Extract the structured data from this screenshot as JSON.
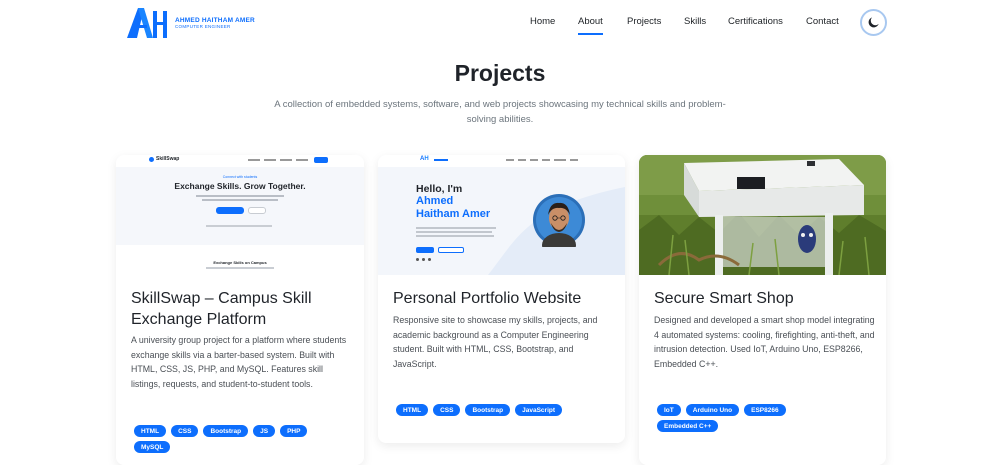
{
  "brand": {
    "mark": "AH",
    "name": "AHMED HAITHAM AMER",
    "subtitle": "COMPUTER ENGINEER"
  },
  "nav": {
    "items": [
      {
        "label": "Home"
      },
      {
        "label": "About"
      },
      {
        "label": "Projects"
      },
      {
        "label": "Skills"
      },
      {
        "label": "Certifications"
      },
      {
        "label": "Contact"
      }
    ],
    "active": "About",
    "theme_icon": "moon-icon"
  },
  "section": {
    "title": "Projects",
    "subtitle": "A collection of embedded systems, software, and web projects showcasing my technical skills and problem-solving abilities."
  },
  "projects": [
    {
      "title": "SkillSwap – Campus Skill Exchange Platform",
      "description": "A university group project for a platform where students exchange skills via a barter-based system. Built with HTML, CSS, JS, PHP, and MySQL. Features skill listings, requests, and student-to-student tools.",
      "tags": [
        "HTML",
        "CSS",
        "Bootstrap",
        "JS",
        "PHP",
        "MySQL"
      ],
      "thumb": {
        "logo": "SkillSwap",
        "headline": "Exchange Skills. Grow Together.",
        "kicker": "Connect with students",
        "section": "Exchange Skills on Campus"
      }
    },
    {
      "title": "Personal Portfolio Website",
      "description": "Responsive site to showcase my skills, projects, and academic background as a Computer Engineering student. Built with HTML, CSS, Bootstrap, and JavaScript.",
      "tags": [
        "HTML",
        "CSS",
        "Bootstrap",
        "JavaScript"
      ],
      "thumb": {
        "hello": "Hello, I'm",
        "name1": "Ahmed",
        "name2": "Haitham Amer"
      }
    },
    {
      "title": "Secure Smart Shop",
      "description": "Designed and developed a smart shop model integrating 4 automated systems: cooling, firefighting, anti-theft, and intrusion detection. Used IoT, Arduino Uno, ESP8266, Embedded C++.",
      "tags": [
        "IoT",
        "Arduino Uno",
        "ESP8266",
        "Embedded C++"
      ],
      "thumb": {}
    }
  ],
  "colors": {
    "accent": "#0d6efd",
    "text": "#212529",
    "muted": "#6c757d"
  }
}
